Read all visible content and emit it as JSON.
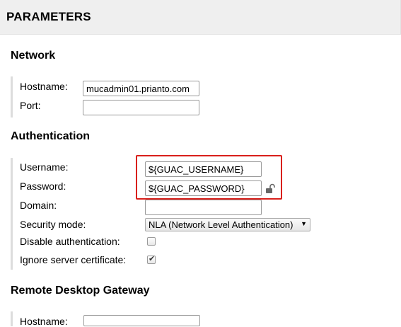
{
  "header": {
    "title": "PARAMETERS"
  },
  "network": {
    "title": "Network",
    "hostname_label": "Hostname:",
    "hostname_value": "mucadmin01.prianto.com",
    "port_label": "Port:",
    "port_value": ""
  },
  "authentication": {
    "title": "Authentication",
    "username_label": "Username:",
    "username_value": "${GUAC_USERNAME}",
    "password_label": "Password:",
    "password_value": "${GUAC_PASSWORD}",
    "domain_label": "Domain:",
    "domain_value": "",
    "security_mode_label": "Security mode:",
    "security_mode_value": "NLA (Network Level Authentication)",
    "disable_auth_label": "Disable authentication:",
    "disable_auth_checked": false,
    "ignore_cert_label": "Ignore server certificate:",
    "ignore_cert_checked": true
  },
  "gateway": {
    "title": "Remote Desktop Gateway",
    "hostname_label": "Hostname:",
    "hostname_value": ""
  },
  "colors": {
    "highlight": "#d9201b",
    "header_bg": "#efefef"
  },
  "icons": {
    "password_toggle": "unlock-icon",
    "select_arrow": "triangle-down-icon",
    "checkmark": "checkmark-icon"
  }
}
